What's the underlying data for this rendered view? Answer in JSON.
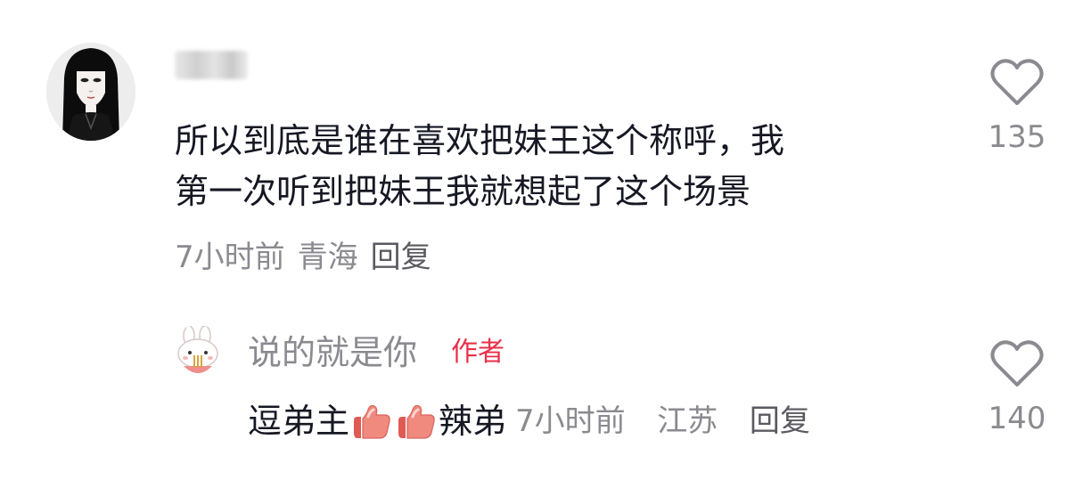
{
  "comment": {
    "username": "刘刘",
    "text_line1": "所以到底是谁在喜欢把妹王这个称呼，我",
    "text_line2": "第一次听到把妹王我就想起了这个场景",
    "time": "7小时前",
    "location": "青海",
    "reply_label": "回复",
    "like_count": "135",
    "like_icon": "heart-outline-icon"
  },
  "reply": {
    "username": "说的就是你",
    "badge": "作者",
    "text_before": "逗弟主",
    "emoji": "thumbs-up-emoji",
    "text_after": "辣弟",
    "time": "7小时前",
    "location": "江苏",
    "reply_label": "回复",
    "like_count": "140",
    "like_icon": "heart-outline-icon"
  },
  "colors": {
    "text_primary": "#161823",
    "text_secondary": "#8a8a90",
    "author_badge": "#e8304a",
    "emoji_peach": "#f0897e"
  }
}
